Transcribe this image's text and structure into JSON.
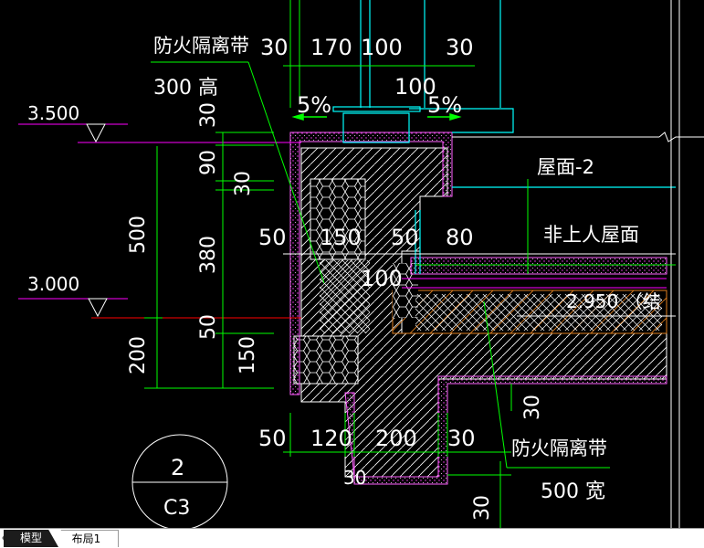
{
  "drawing": {
    "dims_top": {
      "d30a": "30",
      "d170": "170",
      "d100a": "100",
      "d30b": "30",
      "d100b": "100"
    },
    "slope_left": "5%",
    "slope_right": "5%",
    "callout_top": {
      "line1": "防火隔离带",
      "line2": "300 高"
    },
    "callout_bottom": {
      "line1": "防火隔离带",
      "line2": "500 宽"
    },
    "level_upper": "3.500",
    "level_lower": "3.000",
    "vert_dims_left": {
      "d500": "500",
      "d200": "200"
    },
    "vert_dims_mid": {
      "d30": "30",
      "d90": "90",
      "d30b": "30",
      "d380": "380",
      "d50": "50",
      "d150": "150"
    },
    "inner_dims": {
      "d50a": "50",
      "d150": "150",
      "d50b": "50",
      "d80": "80",
      "d100": "100"
    },
    "roof_name": "屋面-2",
    "roof_type": "非上人屋面",
    "structural_level": "2.950 （结",
    "bottom_dims": {
      "d50": "50",
      "d120": "120",
      "d200": "200",
      "d30a": "30",
      "d30b": "30",
      "d30c": "30",
      "d30d": "30"
    },
    "detail_marker": {
      "number": "2",
      "sheet": "C3"
    }
  },
  "tabs": {
    "model": "模型",
    "layout1": "布局1"
  },
  "colors": {
    "background": "#000000",
    "white_text": "#ffffff",
    "green": "#00ff00",
    "cyan": "#00ffff",
    "magenta": "#ff00ff",
    "yellow": "#ffff00",
    "orange": "#e08020",
    "red": "#ff0000"
  }
}
